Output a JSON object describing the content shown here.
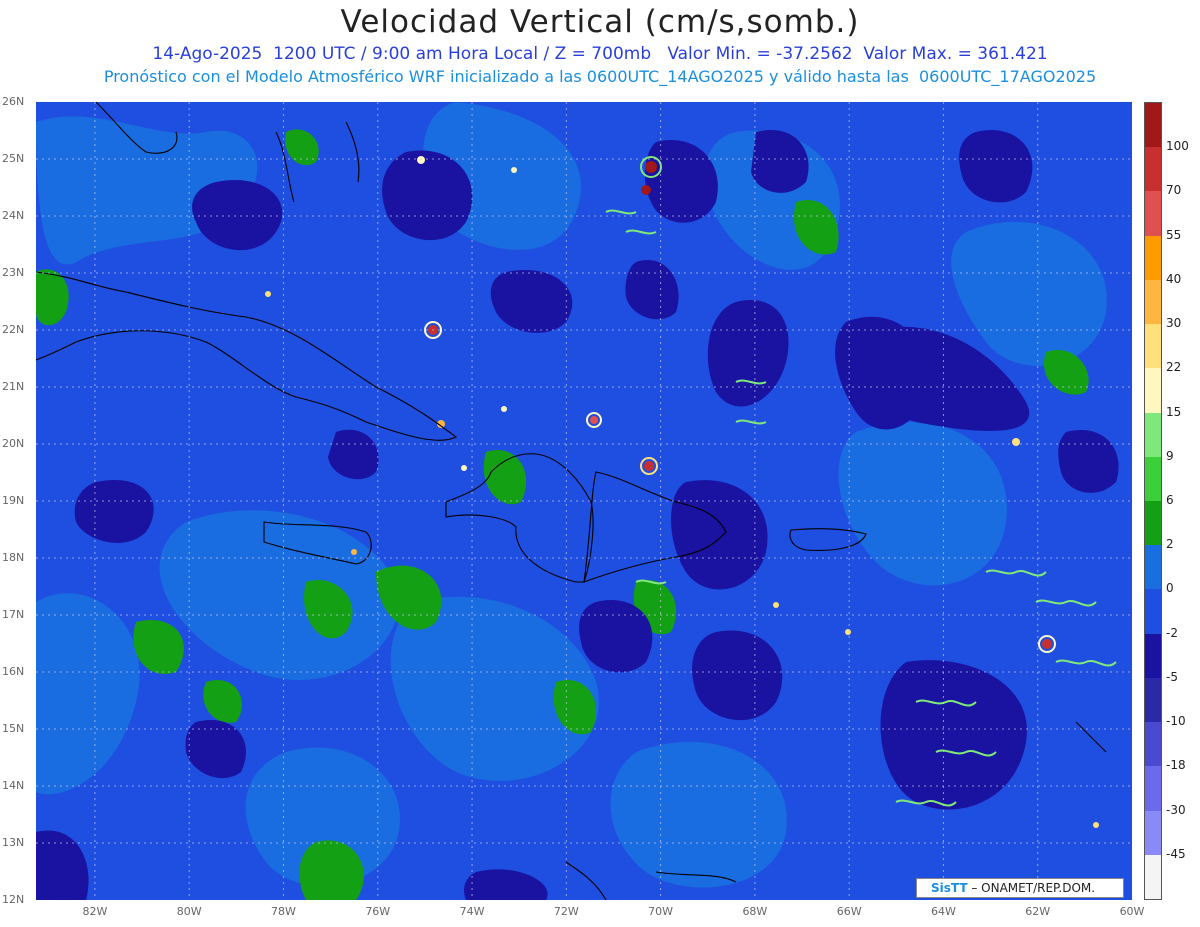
{
  "title": "Velocidad Vertical (cm/s,somb.)",
  "subtitle1": "14-Ago-2025  1200 UTC / 9:00 am Hora Local / Z = 700mb   Valor Min. = -37.2562  Valor Max. = 361.421",
  "subtitle2": "Pronóstico con el Modelo Atmosférico WRF inicializado a las 0600UTC_14AGO2025 y válido hasta las  0600UTC_17AGO2025",
  "lat_labels": [
    "26N",
    "25N",
    "24N",
    "23N",
    "22N",
    "21N",
    "20N",
    "19N",
    "18N",
    "17N",
    "16N",
    "15N",
    "14N",
    "13N",
    "12N"
  ],
  "lon_labels": [
    "82W",
    "80W",
    "78W",
    "76W",
    "74W",
    "72W",
    "70W",
    "68W",
    "66W",
    "64W",
    "62W",
    "60W"
  ],
  "colorbar": {
    "labels": [
      "100",
      "70",
      "55",
      "40",
      "30",
      "22",
      "15",
      "9",
      "6",
      "2",
      "0",
      "-2",
      "-5",
      "-10",
      "-18",
      "-30",
      "-45"
    ],
    "colors": [
      "#a01818",
      "#c83030",
      "#e05050",
      "#ff9a00",
      "#ffb640",
      "#ffe07a",
      "#fff6c0",
      "#7ee87a",
      "#3ccf3c",
      "#14a014",
      "#1a6fe0",
      "#1f4fe0",
      "#1a12a0",
      "#2a2aa8",
      "#4a4ad0",
      "#6a6aea",
      "#8a8af6",
      "#f4f4f4"
    ]
  },
  "credit": {
    "brand": "SisTT",
    "text": " – ONAMET/REP.DOM."
  },
  "map_colors": {
    "ocean": "#1f4fe0",
    "light": "#1a6fe0",
    "down": "#1a12a0",
    "green": "#14a014"
  }
}
